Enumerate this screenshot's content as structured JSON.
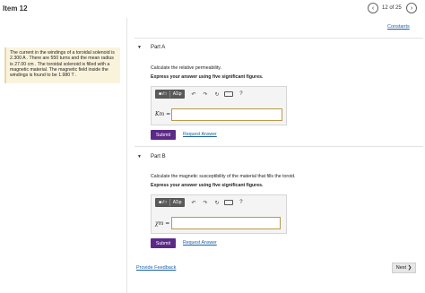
{
  "header": {
    "item_title": "Item 12",
    "counter": "12 of 25",
    "prev_icon": "‹",
    "next_icon": "›"
  },
  "constants_link": "Constants",
  "problem": {
    "text": "The current in the windings of a toroidal solenoid is 2.300 A . There are 550 turns and the mean radius is 27.00 cm . The toroidal solenoid is filled with a magnetic material. The magnetic field inside the windings is found to be 1.980 T ."
  },
  "toolbar": {
    "templates_label": "■√□",
    "symbols_label": "ΑΣφ",
    "undo_icon": "↶",
    "redo_icon": "↷",
    "reset_icon": "↻",
    "keyboard_label": "▭",
    "help_label": "?"
  },
  "part_a": {
    "caret": "▼",
    "title": "Part A",
    "question": "Calculate the relative permeability.",
    "instruction": "Express your answer using five significant figures.",
    "answer_label": "Km =",
    "answer_value": "",
    "submit_label": "Submit",
    "request_label": "Request Answer"
  },
  "part_b": {
    "caret": "▼",
    "title": "Part B",
    "question": "Calculate the magnetic susceptibility of the material that fills the toroid.",
    "instruction": "Express your answer using five significant figures.",
    "answer_label": "χm =",
    "answer_value": "",
    "submit_label": "Submit",
    "request_label": "Request Answer"
  },
  "footer": {
    "feedback_label": "Provide Feedback",
    "next_label": "Next ❯"
  },
  "colors": {
    "submit_bg": "#5b2a86",
    "link": "#1a5fa8",
    "problem_bg": "#faf3dc",
    "input_border": "#b89a4a"
  }
}
